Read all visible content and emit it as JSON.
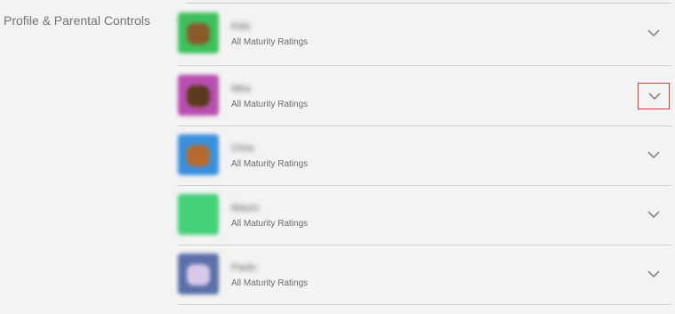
{
  "section": {
    "title": "Profile & Parental Controls"
  },
  "profiles": [
    {
      "name": "Kids",
      "maturity": "All Maturity Ratings",
      "avatar_color": "#3fbf5e",
      "avatar_detail_color": "#8a5a2b",
      "expand_icon": "chevron-down-icon",
      "highlighted": false
    },
    {
      "name": "Mira",
      "maturity": "All Maturity Ratings",
      "avatar_color": "#b84fb0",
      "avatar_detail_color": "#5a3a1e",
      "expand_icon": "chevron-down-icon",
      "highlighted": true
    },
    {
      "name": "Chris",
      "maturity": "All Maturity Ratings",
      "avatar_color": "#3a8fdc",
      "avatar_detail_color": "#b86a2e",
      "expand_icon": "chevron-down-icon",
      "highlighted": false
    },
    {
      "name": "Mauro",
      "maturity": "All Maturity Ratings",
      "avatar_color": "#45d07a",
      "avatar_detail_color": "#45d07a",
      "expand_icon": "chevron-down-icon",
      "highlighted": false
    },
    {
      "name": "Paolo",
      "maturity": "All Maturity Ratings",
      "avatar_color": "#5b6fa8",
      "avatar_detail_color": "#d8c9e8",
      "expand_icon": "chevron-down-icon",
      "highlighted": false
    }
  ],
  "colors": {
    "background": "#f3f3f3",
    "divider": "#d0d0d0",
    "chevron": "#8c8c8c",
    "highlight_border": "#d9333c"
  }
}
